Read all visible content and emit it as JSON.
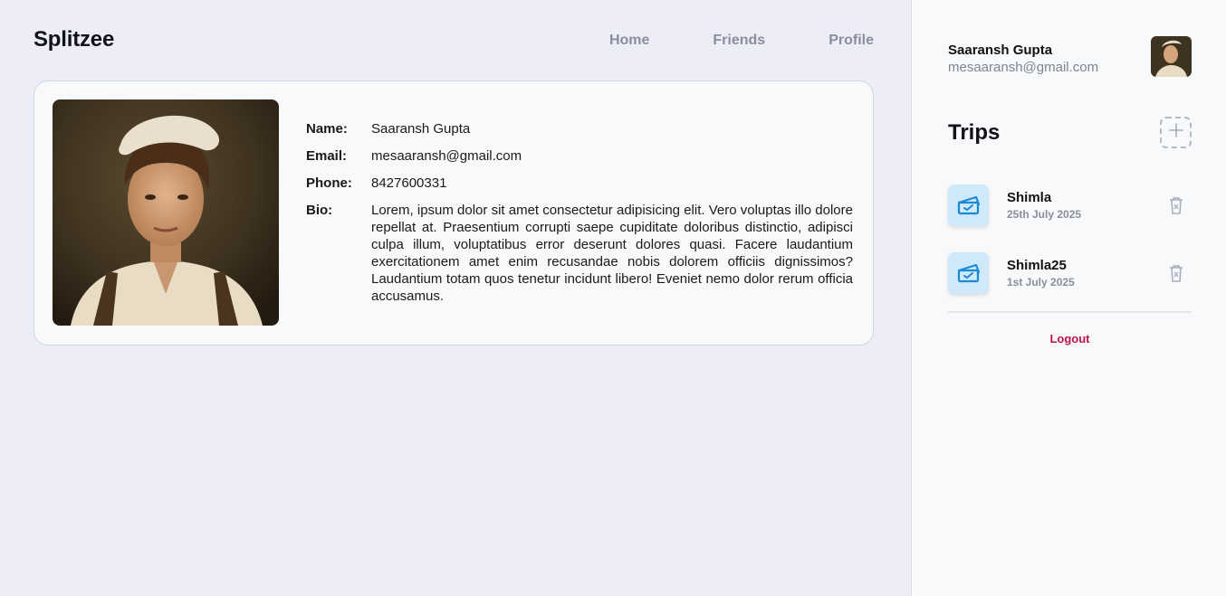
{
  "brand": "Splitzee",
  "nav": {
    "home": "Home",
    "friends": "Friends",
    "profile": "Profile"
  },
  "profile": {
    "name_label": "Name:",
    "name": "Saaransh Gupta",
    "email_label": "Email:",
    "email": "mesaaransh@gmail.com",
    "phone_label": "Phone:",
    "phone": "8427600331",
    "bio_label": "Bio:",
    "bio": "Lorem, ipsum dolor sit amet consectetur adipisicing elit. Vero voluptas illo dolore repellat at. Praesentium corrupti saepe cupiditate doloribus distinctio, adipisci culpa illum, voluptatibus error deserunt dolores quasi. Facere laudantium exercitationem amet enim recusandae nobis dolorem officiis dignissimos? Laudantium totam quos tenetur incidunt libero! Eveniet nemo dolor rerum officia accusamus."
  },
  "sidebar": {
    "user_name": "Saaransh Gupta",
    "user_email": "mesaaransh@gmail.com",
    "trips_heading": "Trips",
    "trips": [
      {
        "name": "Shimla",
        "date": "25th July 2025"
      },
      {
        "name": "Shimla25",
        "date": "1st July 2025"
      }
    ],
    "logout": "Logout"
  },
  "colors": {
    "accent": "#c0134a",
    "trip_icon_bg": "#cfe9fb",
    "trip_icon": "#1a8ad6"
  },
  "icons": {
    "add": "plus-icon",
    "trip": "ticket-icon",
    "delete": "trash-icon"
  }
}
